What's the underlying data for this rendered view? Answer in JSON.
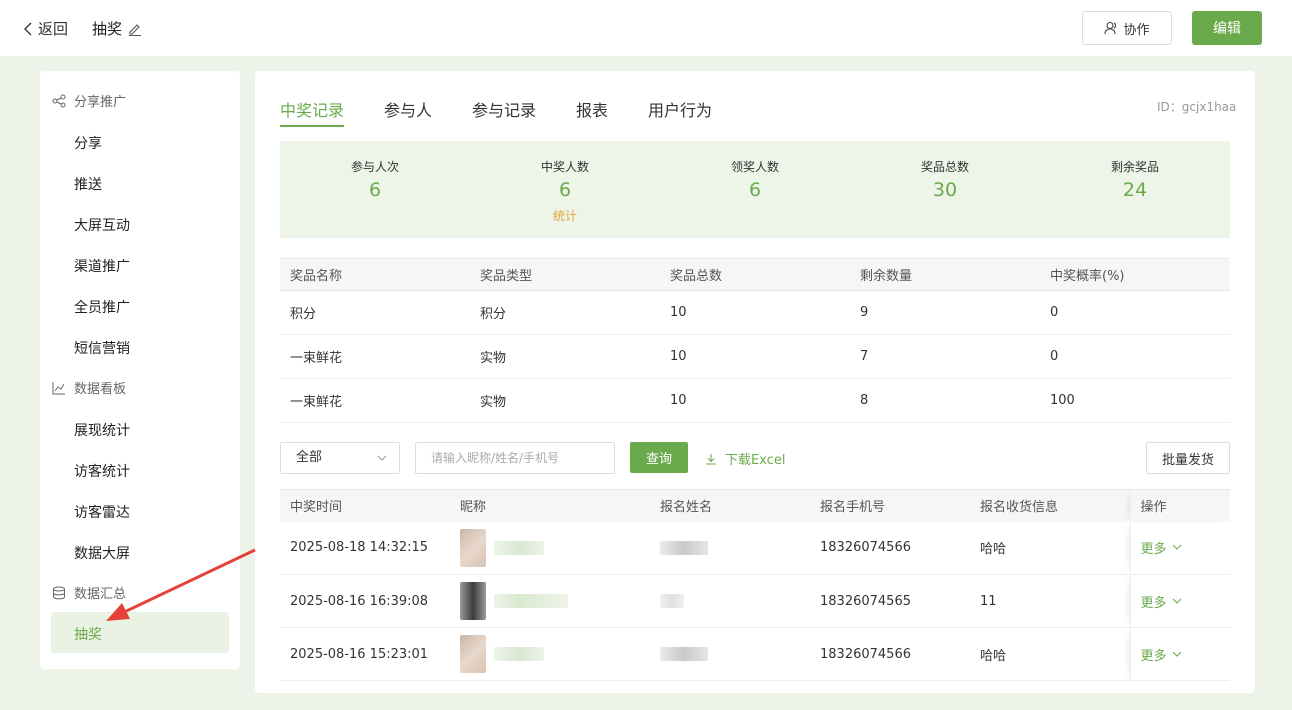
{
  "header": {
    "back_label": "返回",
    "title": "抽奖",
    "collab_label": "协作",
    "edit_label": "编辑"
  },
  "sidebar": {
    "groups": [
      {
        "label": "分享推广",
        "icon": "share-icon"
      },
      {
        "label": "数据看板",
        "icon": "chart-icon"
      },
      {
        "label": "数据汇总",
        "icon": "database-icon"
      }
    ],
    "items": [
      "分享",
      "推送",
      "大屏互动",
      "渠道推广",
      "全员推广",
      "短信营销",
      "展现统计",
      "访客统计",
      "访客雷达",
      "数据大屏",
      "抽奖"
    ],
    "active": "抽奖"
  },
  "tabs": [
    "中奖记录",
    "参与人",
    "参与记录",
    "报表",
    "用户行为"
  ],
  "active_tab": "中奖记录",
  "page_id": "ID：gcjx1haa",
  "stats": [
    {
      "label": "参与人次",
      "value": "6"
    },
    {
      "label": "中奖人数",
      "value": "6",
      "sub": "统计"
    },
    {
      "label": "领奖人数",
      "value": "6"
    },
    {
      "label": "奖品总数",
      "value": "30"
    },
    {
      "label": "剩余奖品",
      "value": "24"
    }
  ],
  "prize_table": {
    "headers": [
      "奖品名称",
      "奖品类型",
      "奖品总数",
      "剩余数量",
      "中奖概率(%)"
    ],
    "rows": [
      [
        "积分",
        "积分",
        "10",
        "9",
        "0"
      ],
      [
        "一束鲜花",
        "实物",
        "10",
        "7",
        "0"
      ],
      [
        "一束鲜花",
        "实物",
        "10",
        "8",
        "100"
      ]
    ]
  },
  "filter": {
    "select_value": "全部",
    "search_placeholder": "请输入昵称/姓名/手机号",
    "query_label": "查询",
    "download_label": "下载Excel",
    "batch_label": "批量发货"
  },
  "winners_table": {
    "headers": [
      "中奖时间",
      "昵称",
      "报名姓名",
      "报名手机号",
      "报名收货信息",
      "操作"
    ],
    "more_label": "更多",
    "rows": [
      {
        "time": "2025-08-18 14:32:15",
        "phone": "18326074566",
        "address": "哈哈"
      },
      {
        "time": "2025-08-16 16:39:08",
        "phone": "18326074565",
        "address": "11"
      },
      {
        "time": "2025-08-16 15:23:01",
        "phone": "18326074566",
        "address": "哈哈"
      }
    ]
  },
  "colors": {
    "accent": "#6aaa4c",
    "stats_bg": "#edf4e8",
    "sub_orange": "#e8a33c",
    "arrow_red": "#e5413a"
  }
}
